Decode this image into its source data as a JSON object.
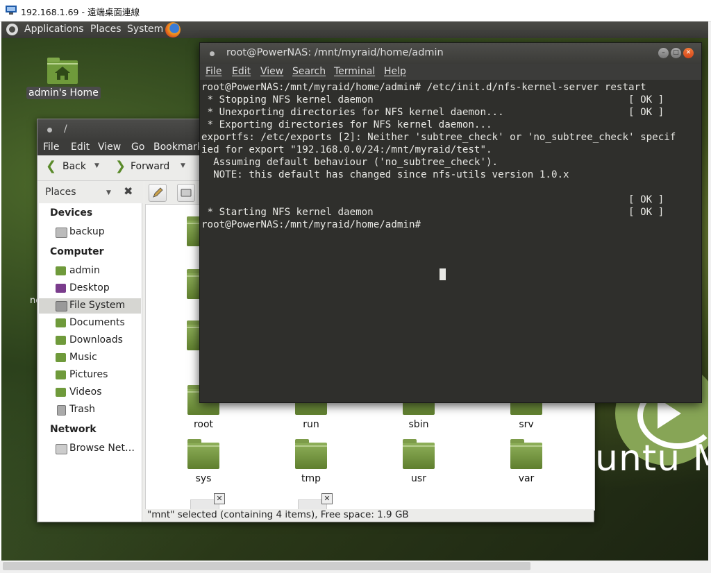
{
  "rdp": {
    "title": "192.168.1.69 - 遠端桌面連線"
  },
  "panel": {
    "menus": [
      "Applications",
      "Places",
      "System"
    ]
  },
  "desktop": {
    "home_icon_label": "admin's Home",
    "partial_label": "ne",
    "brand_text": "untu M"
  },
  "file_manager": {
    "title": "/",
    "menus": [
      "File",
      "Edit",
      "View",
      "Go",
      "Bookmarks"
    ],
    "back_label": "Back",
    "forward_label": "Forward",
    "places_label": "Places",
    "sidebar": {
      "devices_header": "Devices",
      "devices": [
        {
          "label": "backup"
        }
      ],
      "computer_header": "Computer",
      "computer": [
        {
          "label": "admin"
        },
        {
          "label": "Desktop"
        },
        {
          "label": "File System",
          "selected": true
        },
        {
          "label": "Documents"
        },
        {
          "label": "Downloads"
        },
        {
          "label": "Music"
        },
        {
          "label": "Pictures"
        },
        {
          "label": "Videos"
        },
        {
          "label": "Trash"
        }
      ],
      "network_header": "Network",
      "network": [
        {
          "label": "Browse Net…"
        }
      ]
    },
    "folders_partial": [
      "b",
      "ho",
      "m"
    ],
    "folders": [
      "root",
      "run",
      "sbin",
      "srv",
      "sys",
      "tmp",
      "usr",
      "var"
    ],
    "status": "\"mnt\" selected (containing 4 items), Free space: 1.9 GB"
  },
  "terminal": {
    "title": "root@PowerNAS: /mnt/myraid/home/admin",
    "menus": [
      "File",
      "Edit",
      "View",
      "Search",
      "Terminal",
      "Help"
    ],
    "lines": [
      "root@PowerNAS:/mnt/myraid/home/admin# /etc/init.d/nfs-kernel-server restart",
      " * Stopping NFS kernel daemon                                           [ OK ]",
      " * Unexporting directories for NFS kernel daemon...                     [ OK ]",
      " * Exporting directories for NFS kernel daemon...",
      "exportfs: /etc/exports [2]: Neither 'subtree_check' or 'no_subtree_check' specif",
      "ied for export \"192.168.0.0/24:/mnt/myraid/test\".",
      "  Assuming default behaviour ('no_subtree_check').",
      "  NOTE: this default has changed since nfs-utils version 1.0.x",
      "",
      "                                                                        [ OK ]",
      " * Starting NFS kernel daemon                                           [ OK ]",
      "root@PowerNAS:/mnt/myraid/home/admin# "
    ]
  }
}
